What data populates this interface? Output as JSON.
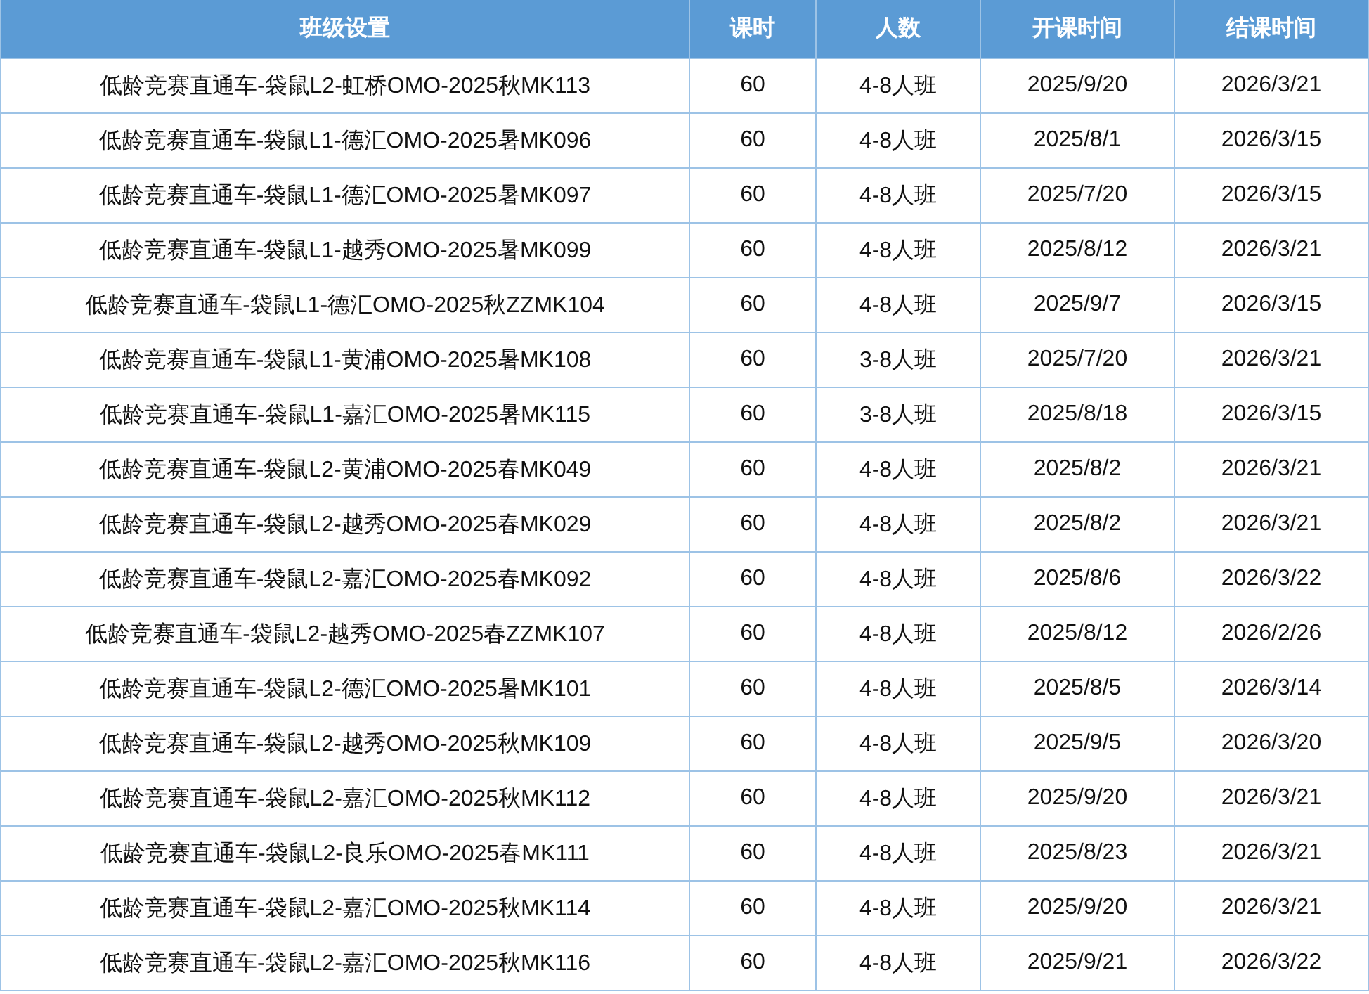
{
  "table": {
    "columns": [
      "班级设置",
      "课时",
      "人数",
      "开课时间",
      "结课时间"
    ],
    "rows": [
      [
        "低龄竞赛直通车-袋鼠L2-虹桥OMO-2025秋MK113",
        "60",
        "4-8人班",
        "2025/9/20",
        "2026/3/21"
      ],
      [
        "低龄竞赛直通车-袋鼠L1-德汇OMO-2025暑MK096",
        "60",
        "4-8人班",
        "2025/8/1",
        "2026/3/15"
      ],
      [
        "低龄竞赛直通车-袋鼠L1-德汇OMO-2025暑MK097",
        "60",
        "4-8人班",
        "2025/7/20",
        "2026/3/15"
      ],
      [
        "低龄竞赛直通车-袋鼠L1-越秀OMO-2025暑MK099",
        "60",
        "4-8人班",
        "2025/8/12",
        "2026/3/21"
      ],
      [
        "低龄竞赛直通车-袋鼠L1-德汇OMO-2025秋ZZMK104",
        "60",
        "4-8人班",
        "2025/9/7",
        "2026/3/15"
      ],
      [
        "低龄竞赛直通车-袋鼠L1-黄浦OMO-2025暑MK108",
        "60",
        "3-8人班",
        "2025/7/20",
        "2026/3/21"
      ],
      [
        "低龄竞赛直通车-袋鼠L1-嘉汇OMO-2025暑MK115",
        "60",
        "3-8人班",
        "2025/8/18",
        "2026/3/15"
      ],
      [
        "低龄竞赛直通车-袋鼠L2-黄浦OMO-2025春MK049",
        "60",
        "4-8人班",
        "2025/8/2",
        "2026/3/21"
      ],
      [
        "低龄竞赛直通车-袋鼠L2-越秀OMO-2025春MK029",
        "60",
        "4-8人班",
        "2025/8/2",
        "2026/3/21"
      ],
      [
        "低龄竞赛直通车-袋鼠L2-嘉汇OMO-2025春MK092",
        "60",
        "4-8人班",
        "2025/8/6",
        "2026/3/22"
      ],
      [
        "低龄竞赛直通车-袋鼠L2-越秀OMO-2025春ZZMK107",
        "60",
        "4-8人班",
        "2025/8/12",
        "2026/2/26"
      ],
      [
        "低龄竞赛直通车-袋鼠L2-德汇OMO-2025暑MK101",
        "60",
        "4-8人班",
        "2025/8/5",
        "2026/3/14"
      ],
      [
        "低龄竞赛直通车-袋鼠L2-越秀OMO-2025秋MK109",
        "60",
        "4-8人班",
        "2025/9/5",
        "2026/3/20"
      ],
      [
        "低龄竞赛直通车-袋鼠L2-嘉汇OMO-2025秋MK112",
        "60",
        "4-8人班",
        "2025/9/20",
        "2026/3/21"
      ],
      [
        "低龄竞赛直通车-袋鼠L2-良乐OMO-2025春MK111",
        "60",
        "4-8人班",
        "2025/8/23",
        "2026/3/21"
      ],
      [
        "低龄竞赛直通车-袋鼠L2-嘉汇OMO-2025秋MK114",
        "60",
        "4-8人班",
        "2025/9/20",
        "2026/3/21"
      ],
      [
        "低龄竞赛直通车-袋鼠L2-嘉汇OMO-2025秋MK116",
        "60",
        "4-8人班",
        "2025/9/21",
        "2026/3/22"
      ]
    ]
  }
}
